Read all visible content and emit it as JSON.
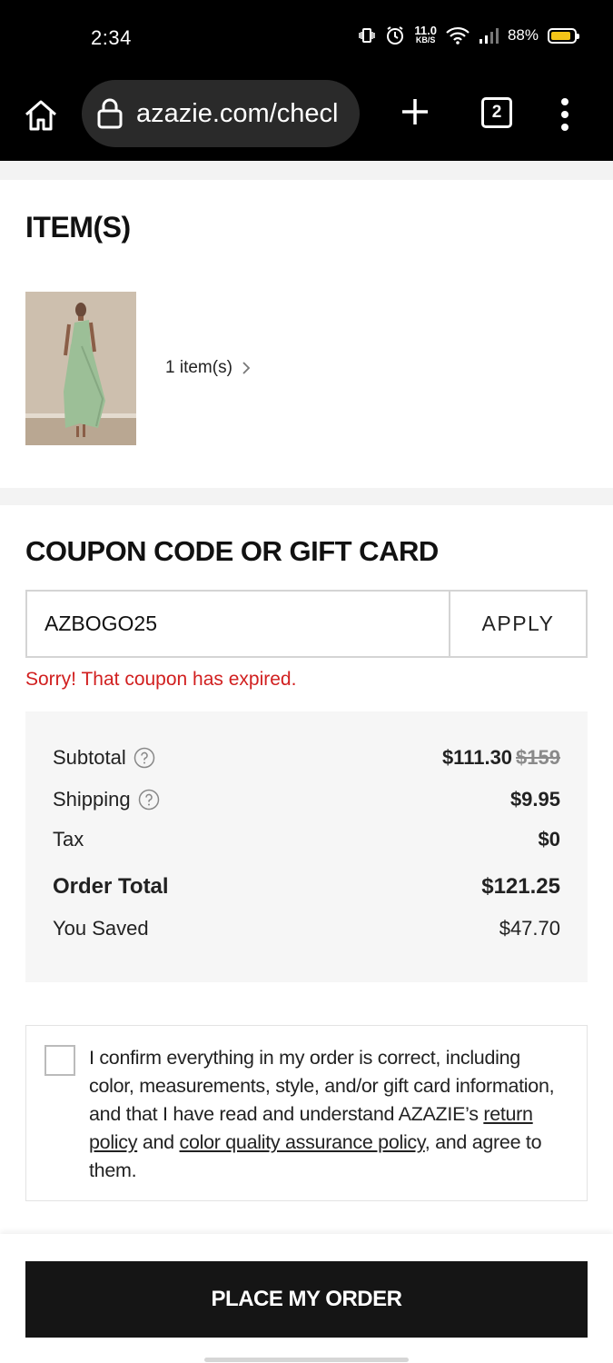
{
  "status_bar": {
    "time": "2:34",
    "net_speed": "11.0",
    "net_unit": "KB/S",
    "battery": "88%",
    "battery_level": 0.88
  },
  "browser": {
    "url": "azazie.com/checl",
    "tab_count": "2"
  },
  "items_section": {
    "title": "ITEM(S)",
    "count_label": "1 item(s)"
  },
  "coupon_section": {
    "title": "COUPON CODE OR GIFT CARD",
    "code_value": "AZBOGO25",
    "apply_label": "APPLY",
    "error": "Sorry! That coupon has expired."
  },
  "summary": {
    "subtotal_label": "Subtotal",
    "subtotal_value": "$111.30",
    "subtotal_original": "$159",
    "shipping_label": "Shipping",
    "shipping_value": "$9.95",
    "tax_label": "Tax",
    "tax_value": "$0",
    "total_label": "Order Total",
    "total_value": "$121.25",
    "saved_label": "You Saved",
    "saved_value": "$47.70"
  },
  "confirm": {
    "text_1": "I confirm everything in my order is correct, including color, measurements, style, and/or gift card information, and that I have read and understand AZAZIE’s ",
    "return_policy": "return policy",
    "text_2": " and ",
    "color_policy": "color quality assurance policy",
    "text_3": ", and agree to them."
  },
  "footer": {
    "place_order_label": "PLACE MY ORDER"
  },
  "colors": {
    "error": "#d11f1f",
    "button_bg": "#151515",
    "dress_green": "#9cbf97"
  }
}
